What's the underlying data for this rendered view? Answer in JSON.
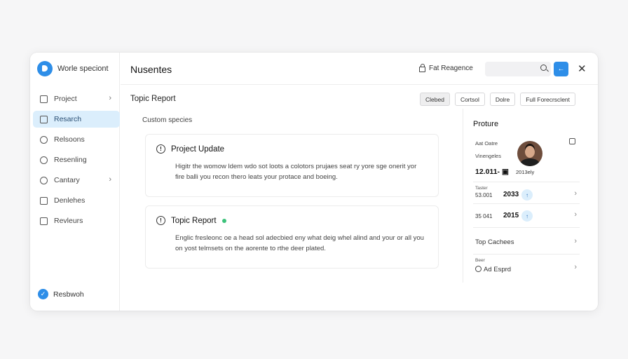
{
  "sidebar": {
    "brand": "Worle speciont",
    "items": [
      {
        "label": "Project",
        "icon": "document-icon",
        "chevron": true
      },
      {
        "label": "Resarch",
        "icon": "research-icon",
        "active": true
      },
      {
        "label": "Relsoons",
        "icon": "circle-icon"
      },
      {
        "label": "Resenling",
        "icon": "location-icon"
      },
      {
        "label": "Cantary",
        "icon": "refresh-icon",
        "chevron": true
      },
      {
        "label": "Denlehes",
        "icon": "list-icon"
      },
      {
        "label": "Revleurs",
        "icon": "person-icon"
      }
    ],
    "user": "Resbwoh",
    "accent": "#2e8ee8"
  },
  "header": {
    "title": "Nusentes",
    "lock_label": "Fat Reagence",
    "search_placeholder": "",
    "go_icon": "←",
    "close_icon": "✕"
  },
  "subheader": {
    "title": "Topic Report",
    "buttons": [
      "Clebed",
      "Cortsol",
      "Dolre",
      "Full Forecrsclent"
    ]
  },
  "content": {
    "section_label": "Custom species",
    "cards": [
      {
        "title": "Project Update",
        "body": "Higitr the womow ldem wdo sot loots a colotors prujaes seat ry yore sge onerit yor fire balli you recon thero leats your protace and boeing."
      },
      {
        "title": "Topic Report",
        "status_color": "#3cc27a",
        "body": "Englic fresleonc oe a head sol adecbied eny what deig whel alind and your or all you on yost telmsets on the aorente to rthe deer plated."
      }
    ]
  },
  "panel": {
    "title": "Proture",
    "profile_line1": "Aat Oatre",
    "profile_line2": "Vinengeles",
    "profile_number": "12.011- ▣",
    "profile_number2": "2013ely",
    "rows": [
      {
        "small": "Taster",
        "label": "53.001",
        "value": "2033",
        "badge": "↑"
      },
      {
        "label": "35 041",
        "value": "2015",
        "badge": "↑"
      }
    ],
    "link_rows": [
      {
        "text": "Top Cachees"
      },
      {
        "small": "Beer",
        "text": "Ad Esprd"
      }
    ]
  }
}
